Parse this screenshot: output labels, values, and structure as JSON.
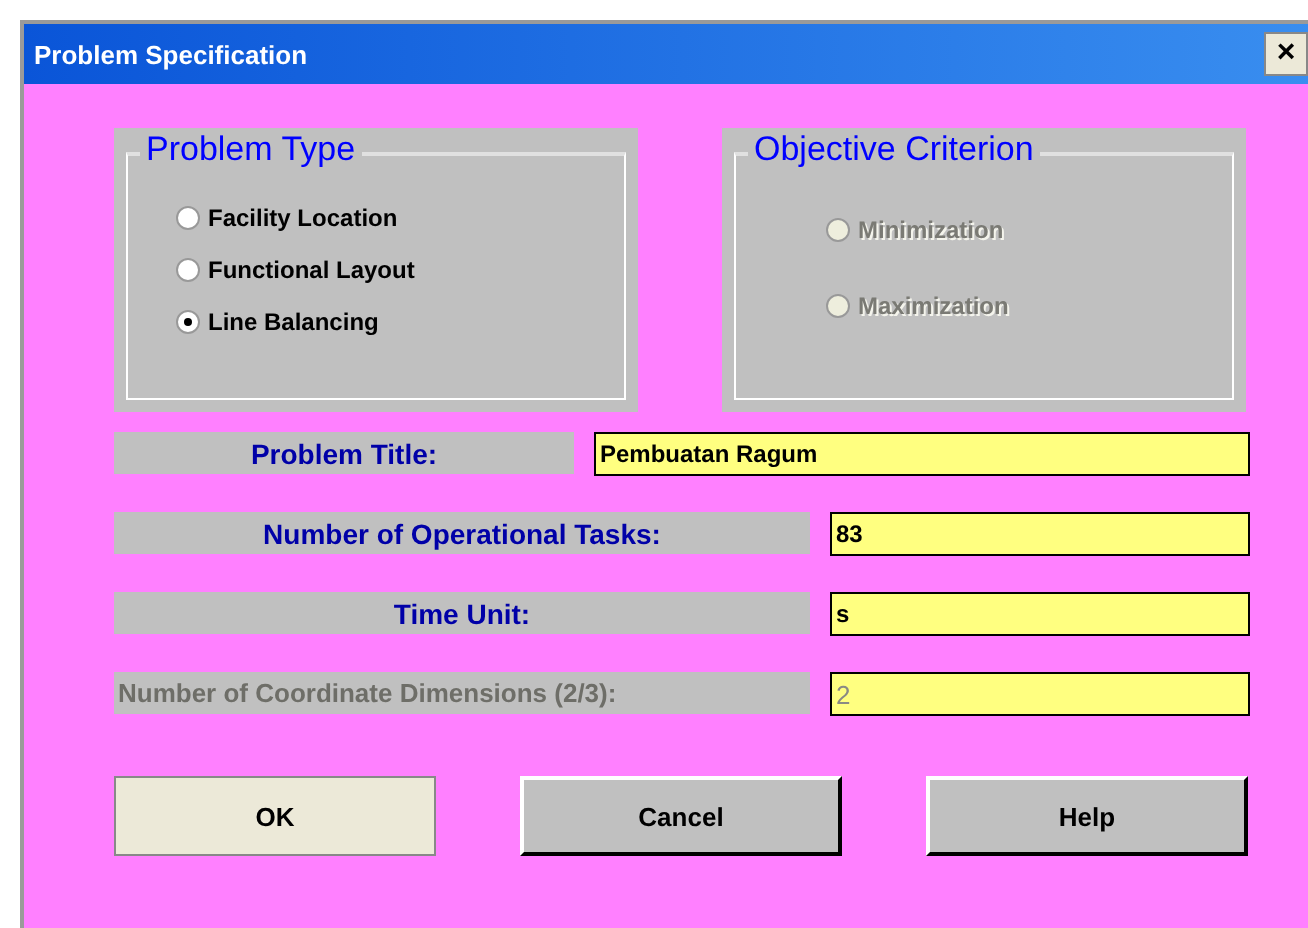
{
  "window": {
    "title": "Problem Specification",
    "close": "×"
  },
  "problem_type": {
    "title": "Problem Type",
    "disabled": false,
    "options": [
      {
        "label": "Facility Location",
        "selected": false
      },
      {
        "label": "Functional Layout",
        "selected": false
      },
      {
        "label": "Line Balancing",
        "selected": true
      }
    ]
  },
  "objective_criterion": {
    "title": "Objective Criterion",
    "disabled": true,
    "options": [
      {
        "label": "Minimization",
        "selected": false
      },
      {
        "label": "Maximization",
        "selected": false
      }
    ]
  },
  "fields": [
    {
      "label": "Problem Title:",
      "value": "Pembuatan Ragum",
      "wide": true,
      "disabled": false
    },
    {
      "label": "Number of Operational Tasks:",
      "value": "83",
      "wide": false,
      "disabled": false
    },
    {
      "label": "Time Unit:",
      "value": "s",
      "wide": false,
      "disabled": false
    },
    {
      "label": "Number of Coordinate Dimensions (2/3):",
      "value": "2",
      "wide": false,
      "disabled": true
    }
  ],
  "buttons": [
    {
      "label": "OK",
      "selected": true
    },
    {
      "label": "Cancel",
      "selected": false
    },
    {
      "label": "Help",
      "selected": false
    }
  ]
}
